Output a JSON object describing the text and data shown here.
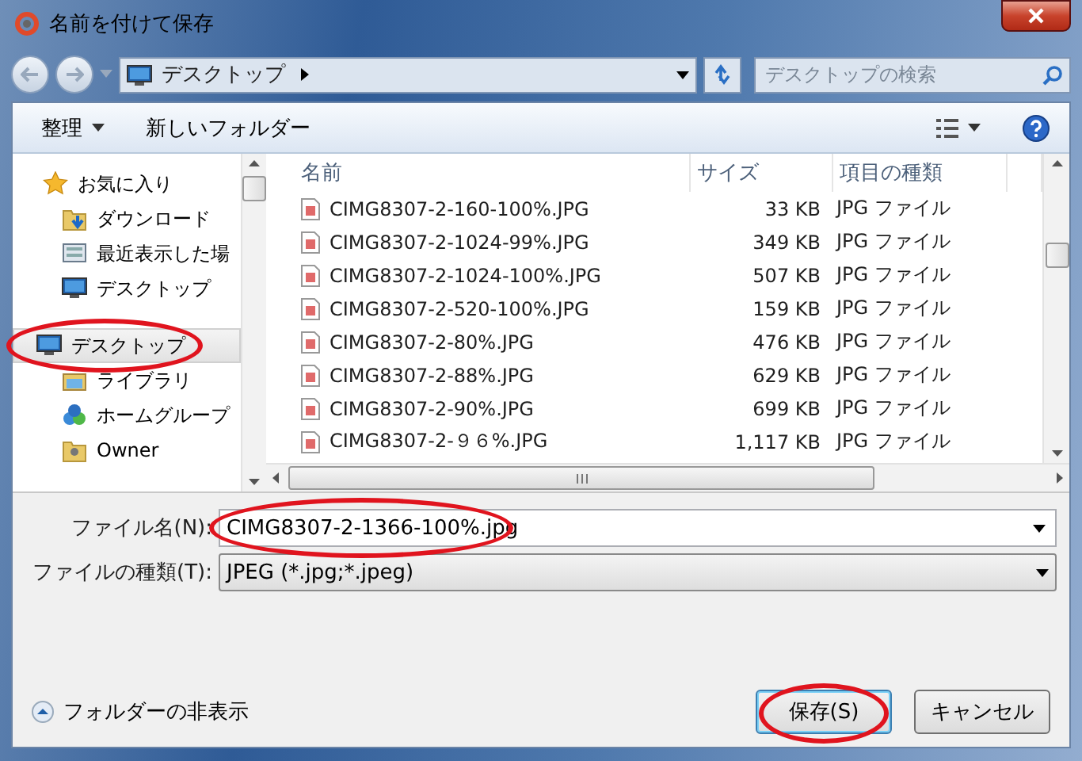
{
  "window": {
    "title": "名前を付けて保存"
  },
  "address": {
    "location": "デスクトップ",
    "search_placeholder": "デスクトップの検索"
  },
  "toolbar": {
    "organize": "整理",
    "new_folder": "新しいフォルダー"
  },
  "sidebar": {
    "items": [
      {
        "label": "お気に入り",
        "kind": "favorites",
        "selected": false,
        "circled": false
      },
      {
        "label": "ダウンロード",
        "kind": "downloads",
        "selected": false,
        "circled": false
      },
      {
        "label": "最近表示した場",
        "kind": "recent",
        "selected": false,
        "circled": false
      },
      {
        "label": "デスクトップ",
        "kind": "desktop",
        "selected": false,
        "circled": false
      },
      {
        "label": "デスクトップ",
        "kind": "desktop",
        "selected": true,
        "circled": true
      },
      {
        "label": "ライブラリ",
        "kind": "library",
        "selected": false,
        "circled": false
      },
      {
        "label": "ホームグループ",
        "kind": "homegroup",
        "selected": false,
        "circled": false
      },
      {
        "label": "Owner",
        "kind": "user",
        "selected": false,
        "circled": false
      }
    ]
  },
  "table": {
    "columns": [
      "名前",
      "サイズ",
      "項目の種類"
    ],
    "rows": [
      {
        "name": "CIMG8307-2-160-100%.JPG",
        "size": "33 KB",
        "type": "JPG ファイル"
      },
      {
        "name": "CIMG8307-2-1024-99%.JPG",
        "size": "349 KB",
        "type": "JPG ファイル"
      },
      {
        "name": "CIMG8307-2-1024-100%.JPG",
        "size": "507 KB",
        "type": "JPG ファイル"
      },
      {
        "name": "CIMG8307-2-520-100%.JPG",
        "size": "159 KB",
        "type": "JPG ファイル"
      },
      {
        "name": "CIMG8307-2-80%.JPG",
        "size": "476 KB",
        "type": "JPG ファイル"
      },
      {
        "name": "CIMG8307-2-88%.JPG",
        "size": "629 KB",
        "type": "JPG ファイル"
      },
      {
        "name": "CIMG8307-2-90%.JPG",
        "size": "699 KB",
        "type": "JPG ファイル"
      },
      {
        "name": "CIMG8307-2-９６%.JPG",
        "size": "1,117 KB",
        "type": "JPG ファイル"
      }
    ]
  },
  "form": {
    "filename_label": "ファイル名(N):",
    "filename": "CIMG8307-2-1366-100%.jpg",
    "filename_circled": true,
    "filetype_label": "ファイルの種類(T):",
    "filetype": "JPEG (*.jpg;*.jpeg)"
  },
  "footer": {
    "hide_folders": "フォルダーの非表示",
    "buttons": [
      {
        "label": "保存(S)",
        "kind": "default",
        "circled": true
      },
      {
        "label": "キャンセル",
        "kind": "normal",
        "circled": false
      }
    ]
  }
}
